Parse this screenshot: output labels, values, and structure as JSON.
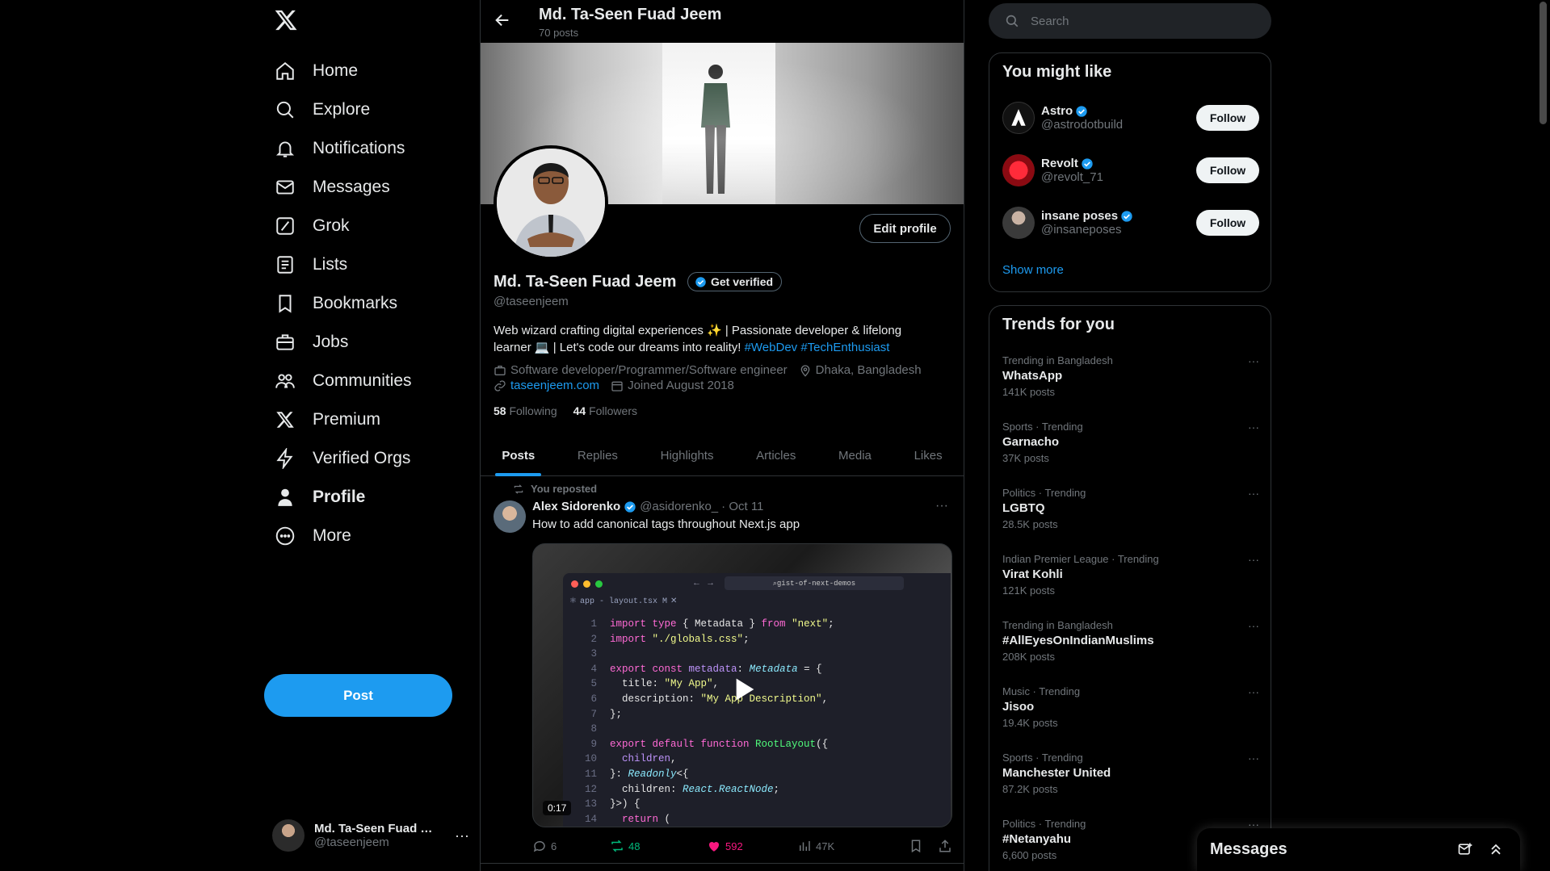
{
  "nav": {
    "items": [
      {
        "label": "Home",
        "icon": "home-icon"
      },
      {
        "label": "Explore",
        "icon": "search-icon"
      },
      {
        "label": "Notifications",
        "icon": "bell-icon"
      },
      {
        "label": "Messages",
        "icon": "mail-icon"
      },
      {
        "label": "Grok",
        "icon": "grok-icon"
      },
      {
        "label": "Lists",
        "icon": "list-icon"
      },
      {
        "label": "Bookmarks",
        "icon": "bookmark-icon"
      },
      {
        "label": "Jobs",
        "icon": "briefcase-icon"
      },
      {
        "label": "Communities",
        "icon": "people-icon"
      },
      {
        "label": "Premium",
        "icon": "x-logo-icon"
      },
      {
        "label": "Verified Orgs",
        "icon": "lightning-icon"
      },
      {
        "label": "Profile",
        "icon": "person-icon"
      },
      {
        "label": "More",
        "icon": "more-circle-icon"
      }
    ],
    "post_button": "Post",
    "account": {
      "name": "Md. Ta-Seen Fuad Jeem",
      "handle": "@taseenjeem"
    }
  },
  "header": {
    "title": "Md. Ta-Seen Fuad Jeem",
    "post_count": "70 posts"
  },
  "profile": {
    "edit_button": "Edit profile",
    "name": "Md. Ta-Seen Fuad Jeem",
    "get_verified": "Get verified",
    "handle": "@taseenjeem",
    "bio_line1": "Web wizard crafting digital experiences ✨ | Passionate developer & lifelong",
    "bio_line2": "learner 💻 | Let's code our dreams into reality! ",
    "hashtag1": "#WebDev",
    "hashtag2": "#TechEnthusiast",
    "profession": "Software developer/Programmer/Software engineer",
    "location": "Dhaka, Bangladesh",
    "website": "taseenjeem.com",
    "joined": "Joined August 2018",
    "following_count": "58",
    "following_label": "Following",
    "followers_count": "44",
    "followers_label": "Followers"
  },
  "tabs": [
    "Posts",
    "Replies",
    "Highlights",
    "Articles",
    "Media",
    "Likes"
  ],
  "post": {
    "repost_note": "You reposted",
    "author": "Alex Sidorenko",
    "handle": "@asidorenko_",
    "date": "· Oct 11",
    "text": "How to add canonical tags throughout Next.js app",
    "video_url_bar": "gist-of-next-demos",
    "video_file_tab": "app - layout.tsx M",
    "duration": "0:17",
    "replies": "6",
    "reposts": "48",
    "likes": "592",
    "views": "47K"
  },
  "right": {
    "search_placeholder": "Search",
    "you_might_like_title": "You might like",
    "suggestions": [
      {
        "name": "Astro",
        "handle": "@astrodotbuild",
        "button": "Follow"
      },
      {
        "name": "Revolt",
        "handle": "@revolt_71",
        "button": "Follow"
      },
      {
        "name": "insane poses",
        "handle": "@insaneposes",
        "button": "Follow"
      }
    ],
    "show_more": "Show more",
    "trends_title": "Trends for you",
    "trends": [
      {
        "context": "Trending in Bangladesh",
        "title": "WhatsApp",
        "posts": "141K posts"
      },
      {
        "context": "Sports · Trending",
        "title": "Garnacho",
        "posts": "37K posts"
      },
      {
        "context": "Politics · Trending",
        "title": "LGBTQ",
        "posts": "28.5K posts"
      },
      {
        "context": "Indian Premier League · Trending",
        "title": "Virat Kohli",
        "posts": "121K posts"
      },
      {
        "context": "Trending in Bangladesh",
        "title": "#AllEyesOnIndianMuslims",
        "posts": "208K posts"
      },
      {
        "context": "Music · Trending",
        "title": "Jisoo",
        "posts": "19.4K posts"
      },
      {
        "context": "Sports · Trending",
        "title": "Manchester United",
        "posts": "87.2K posts"
      },
      {
        "context": "Politics · Trending",
        "title": "#Netanyahu",
        "posts": "6,600 posts"
      }
    ]
  },
  "messages_drawer": {
    "title": "Messages"
  },
  "colors": {
    "accent": "#1d9bf0",
    "like": "#f91880",
    "repost": "#00ba7c",
    "background": "#000000",
    "muted": "#71767b"
  }
}
